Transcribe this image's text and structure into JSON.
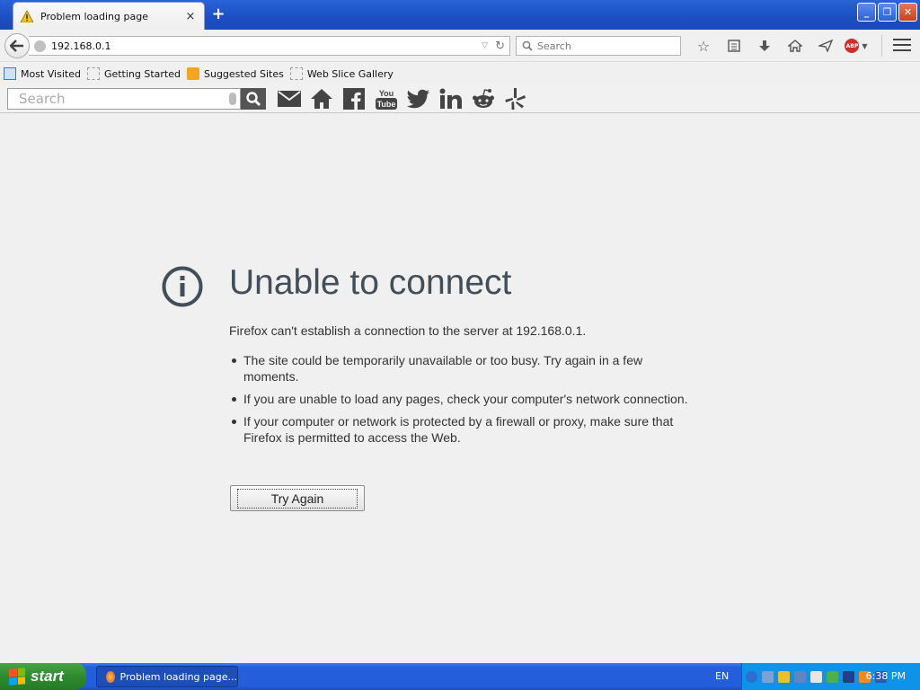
{
  "window": {
    "tab_title": "Problem loading page",
    "tab_close": "×",
    "new_tab": "+",
    "win_minimize": "_",
    "win_restore": "❐",
    "win_close": "✕"
  },
  "nav": {
    "url": "192.168.0.1",
    "search_placeholder": "Search"
  },
  "bookmarks": [
    {
      "label": "Most Visited",
      "icon": "most-visited-icon"
    },
    {
      "label": "Getting Started",
      "icon": "page-icon"
    },
    {
      "label": "Suggested Sites",
      "icon": "suggested-sites-icon"
    },
    {
      "label": "Web Slice Gallery",
      "icon": "page-icon"
    }
  ],
  "addon_toolbar": {
    "search_placeholder": "Search",
    "icons": [
      "mail-icon",
      "home-icon",
      "facebook-icon",
      "youtube-icon",
      "twitter-icon",
      "linkedin-icon",
      "reddit-icon",
      "yelp-icon"
    ],
    "youtube_label": "You Tube",
    "linkedin_label": "in"
  },
  "error": {
    "heading": "Unable to connect",
    "description": "Firefox can't establish a connection to the server at 192.168.0.1.",
    "bullets": [
      "The site could be temporarily unavailable or too busy. Try again in a few moments.",
      "If you are unable to load any pages, check your computer's network connection.",
      "If your computer or network is protected by a firewall or proxy, make sure that Firefox is permitted to access the Web."
    ],
    "try_again": "Try Again"
  },
  "taskbar": {
    "start": "start",
    "task_item": "Problem loading page...",
    "language": "EN",
    "clock": "6:38 PM"
  },
  "colors": {
    "heading": "#424e5a",
    "taskbar": "#245edb",
    "start_green": "#2e8b2e",
    "titlebar": "#1c4fc4"
  }
}
